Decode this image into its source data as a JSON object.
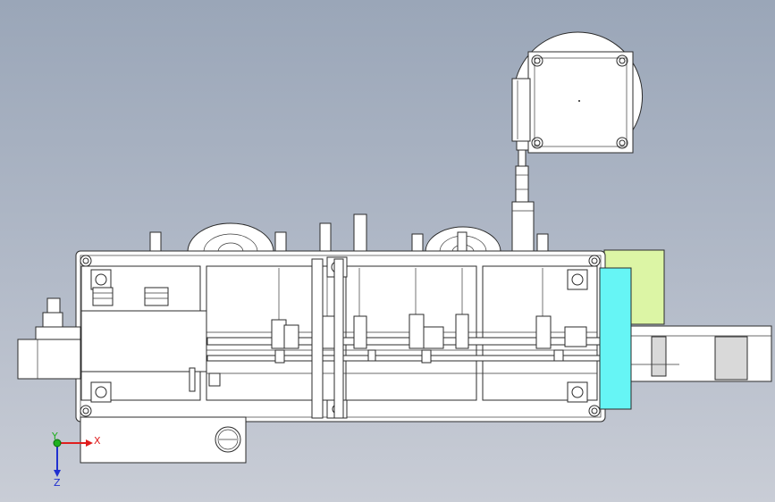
{
  "viewport": {
    "background_top": "#9aa6b8",
    "background_bottom": "#c9cdd6"
  },
  "triad": {
    "x_label": "X",
    "y_label": "Y",
    "z_label": "Z",
    "x_color": "#e01e1e",
    "y_color": "#1fb01f",
    "z_color": "#2030d0"
  },
  "highlights": {
    "cyan_plate_color": "#66f5f5",
    "green_block_color": "#dcf5a5"
  }
}
